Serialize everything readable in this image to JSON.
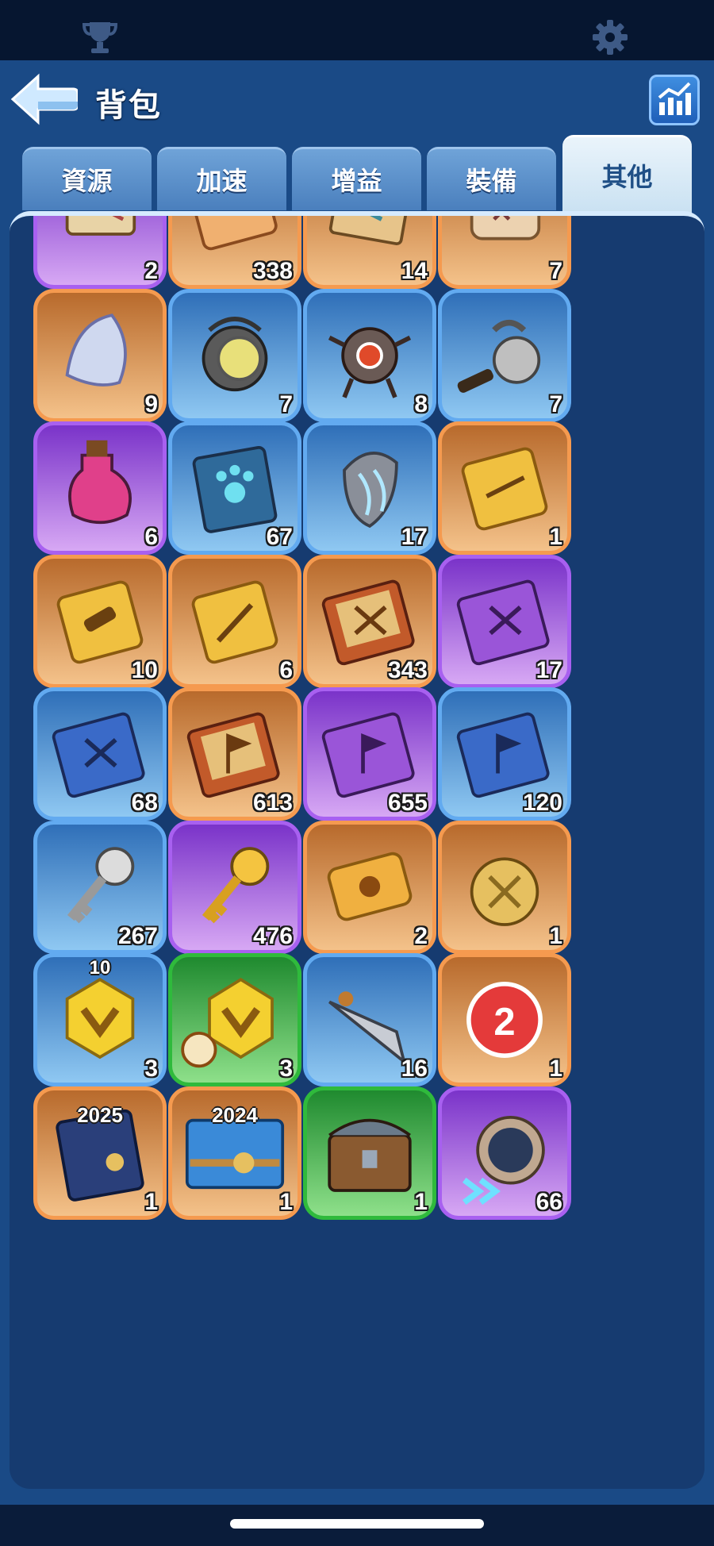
{
  "header": {
    "title": "背包",
    "back_icon": "back-arrow-icon",
    "stats_icon": "bar-chart-icon"
  },
  "topbar": {
    "left_icon": "trophy-icon",
    "right_icon": "gear-icon"
  },
  "tabs": [
    {
      "label": "資源",
      "active": false
    },
    {
      "label": "加速",
      "active": false
    },
    {
      "label": "增益",
      "active": false
    },
    {
      "label": "裝備",
      "active": false
    },
    {
      "label": "其他",
      "active": true
    }
  ],
  "items": [
    {
      "icon": "map-scroll-icon",
      "count": "2",
      "rarity": "purple"
    },
    {
      "icon": "ticket-icon",
      "count": "338",
      "rarity": "orange"
    },
    {
      "icon": "treasure-map-icon",
      "count": "14",
      "rarity": "orange"
    },
    {
      "icon": "parchment-scroll-icon",
      "count": "7",
      "rarity": "orange"
    },
    {
      "icon": "seashell-icon",
      "count": "9",
      "rarity": "orange"
    },
    {
      "icon": "diving-helmet-icon",
      "count": "7",
      "rarity": "blue"
    },
    {
      "icon": "robot-drone-icon",
      "count": "8",
      "rarity": "blue"
    },
    {
      "icon": "fishing-reel-icon",
      "count": "7",
      "rarity": "blue"
    },
    {
      "icon": "pet-potion-icon",
      "count": "6",
      "rarity": "purple"
    },
    {
      "icon": "paw-book-icon",
      "count": "67",
      "rarity": "blue"
    },
    {
      "icon": "claw-stone-icon",
      "count": "17",
      "rarity": "blue"
    },
    {
      "icon": "archer-card-icon",
      "count": "1",
      "rarity": "orange"
    },
    {
      "icon": "cannon-card-icon",
      "count": "10",
      "rarity": "orange"
    },
    {
      "icon": "sword-card-icon",
      "count": "6",
      "rarity": "orange"
    },
    {
      "icon": "orange-swords-book-icon",
      "count": "343",
      "rarity": "orange"
    },
    {
      "icon": "purple-swords-book-icon",
      "count": "17",
      "rarity": "purple"
    },
    {
      "icon": "blue-swords-notebook-icon",
      "count": "68",
      "rarity": "blue"
    },
    {
      "icon": "orange-flag-book-icon",
      "count": "613",
      "rarity": "orange"
    },
    {
      "icon": "purple-flag-book-icon",
      "count": "655",
      "rarity": "purple"
    },
    {
      "icon": "blue-flag-notebook-icon",
      "count": "120",
      "rarity": "blue"
    },
    {
      "icon": "silver-key-icon",
      "count": "267",
      "rarity": "blue"
    },
    {
      "icon": "gold-key-icon",
      "count": "476",
      "rarity": "purple"
    },
    {
      "icon": "siege-ticket-icon",
      "count": "2",
      "rarity": "orange"
    },
    {
      "icon": "gold-medal-tag-icon",
      "count": "1",
      "rarity": "orange"
    },
    {
      "icon": "vip-hexagon-icon",
      "count": "3",
      "rarity": "blue",
      "tier": "10"
    },
    {
      "icon": "vip-hexagon-timed-icon",
      "count": "3",
      "rarity": "green"
    },
    {
      "icon": "spear-tip-icon",
      "count": "16",
      "rarity": "blue"
    },
    {
      "icon": "second-place-badge-icon",
      "count": "1",
      "rarity": "orange"
    },
    {
      "icon": "2025-journal-icon",
      "count": "1",
      "rarity": "orange",
      "label": "2025"
    },
    {
      "icon": "2024-banner-icon",
      "count": "1",
      "rarity": "orange",
      "label": "2024"
    },
    {
      "icon": "treasure-chest-icon",
      "count": "1",
      "rarity": "green"
    },
    {
      "icon": "speed-compass-icon",
      "count": "66",
      "rarity": "purple"
    }
  ]
}
